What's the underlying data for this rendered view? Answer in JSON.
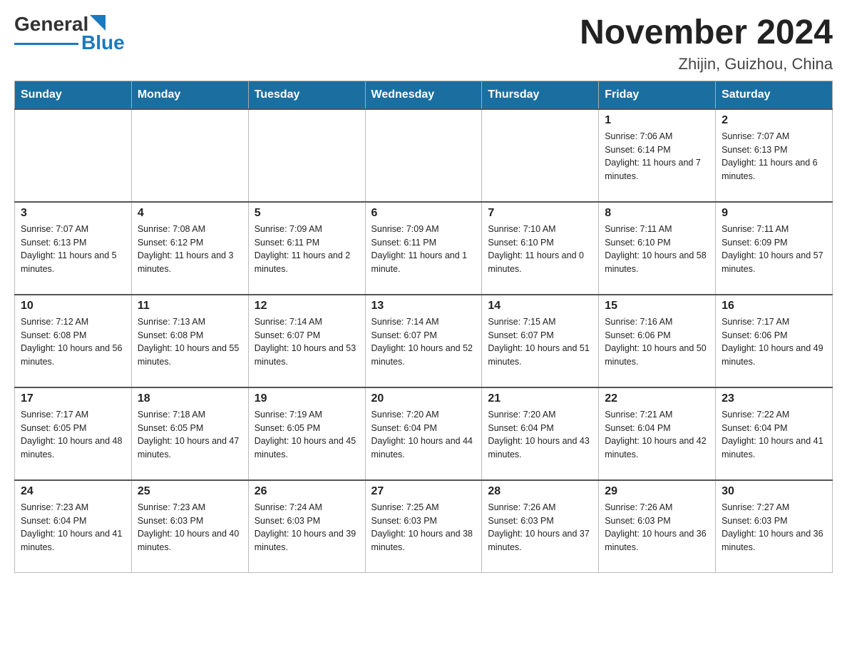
{
  "header": {
    "logo_general": "General",
    "logo_blue": "Blue",
    "main_title": "November 2024",
    "subtitle": "Zhijin, Guizhou, China"
  },
  "days_of_week": [
    "Sunday",
    "Monday",
    "Tuesday",
    "Wednesday",
    "Thursday",
    "Friday",
    "Saturday"
  ],
  "weeks": [
    [
      {
        "day": "",
        "info": ""
      },
      {
        "day": "",
        "info": ""
      },
      {
        "day": "",
        "info": ""
      },
      {
        "day": "",
        "info": ""
      },
      {
        "day": "",
        "info": ""
      },
      {
        "day": "1",
        "info": "Sunrise: 7:06 AM\nSunset: 6:14 PM\nDaylight: 11 hours and 7 minutes."
      },
      {
        "day": "2",
        "info": "Sunrise: 7:07 AM\nSunset: 6:13 PM\nDaylight: 11 hours and 6 minutes."
      }
    ],
    [
      {
        "day": "3",
        "info": "Sunrise: 7:07 AM\nSunset: 6:13 PM\nDaylight: 11 hours and 5 minutes."
      },
      {
        "day": "4",
        "info": "Sunrise: 7:08 AM\nSunset: 6:12 PM\nDaylight: 11 hours and 3 minutes."
      },
      {
        "day": "5",
        "info": "Sunrise: 7:09 AM\nSunset: 6:11 PM\nDaylight: 11 hours and 2 minutes."
      },
      {
        "day": "6",
        "info": "Sunrise: 7:09 AM\nSunset: 6:11 PM\nDaylight: 11 hours and 1 minute."
      },
      {
        "day": "7",
        "info": "Sunrise: 7:10 AM\nSunset: 6:10 PM\nDaylight: 11 hours and 0 minutes."
      },
      {
        "day": "8",
        "info": "Sunrise: 7:11 AM\nSunset: 6:10 PM\nDaylight: 10 hours and 58 minutes."
      },
      {
        "day": "9",
        "info": "Sunrise: 7:11 AM\nSunset: 6:09 PM\nDaylight: 10 hours and 57 minutes."
      }
    ],
    [
      {
        "day": "10",
        "info": "Sunrise: 7:12 AM\nSunset: 6:08 PM\nDaylight: 10 hours and 56 minutes."
      },
      {
        "day": "11",
        "info": "Sunrise: 7:13 AM\nSunset: 6:08 PM\nDaylight: 10 hours and 55 minutes."
      },
      {
        "day": "12",
        "info": "Sunrise: 7:14 AM\nSunset: 6:07 PM\nDaylight: 10 hours and 53 minutes."
      },
      {
        "day": "13",
        "info": "Sunrise: 7:14 AM\nSunset: 6:07 PM\nDaylight: 10 hours and 52 minutes."
      },
      {
        "day": "14",
        "info": "Sunrise: 7:15 AM\nSunset: 6:07 PM\nDaylight: 10 hours and 51 minutes."
      },
      {
        "day": "15",
        "info": "Sunrise: 7:16 AM\nSunset: 6:06 PM\nDaylight: 10 hours and 50 minutes."
      },
      {
        "day": "16",
        "info": "Sunrise: 7:17 AM\nSunset: 6:06 PM\nDaylight: 10 hours and 49 minutes."
      }
    ],
    [
      {
        "day": "17",
        "info": "Sunrise: 7:17 AM\nSunset: 6:05 PM\nDaylight: 10 hours and 48 minutes."
      },
      {
        "day": "18",
        "info": "Sunrise: 7:18 AM\nSunset: 6:05 PM\nDaylight: 10 hours and 47 minutes."
      },
      {
        "day": "19",
        "info": "Sunrise: 7:19 AM\nSunset: 6:05 PM\nDaylight: 10 hours and 45 minutes."
      },
      {
        "day": "20",
        "info": "Sunrise: 7:20 AM\nSunset: 6:04 PM\nDaylight: 10 hours and 44 minutes."
      },
      {
        "day": "21",
        "info": "Sunrise: 7:20 AM\nSunset: 6:04 PM\nDaylight: 10 hours and 43 minutes."
      },
      {
        "day": "22",
        "info": "Sunrise: 7:21 AM\nSunset: 6:04 PM\nDaylight: 10 hours and 42 minutes."
      },
      {
        "day": "23",
        "info": "Sunrise: 7:22 AM\nSunset: 6:04 PM\nDaylight: 10 hours and 41 minutes."
      }
    ],
    [
      {
        "day": "24",
        "info": "Sunrise: 7:23 AM\nSunset: 6:04 PM\nDaylight: 10 hours and 41 minutes."
      },
      {
        "day": "25",
        "info": "Sunrise: 7:23 AM\nSunset: 6:03 PM\nDaylight: 10 hours and 40 minutes."
      },
      {
        "day": "26",
        "info": "Sunrise: 7:24 AM\nSunset: 6:03 PM\nDaylight: 10 hours and 39 minutes."
      },
      {
        "day": "27",
        "info": "Sunrise: 7:25 AM\nSunset: 6:03 PM\nDaylight: 10 hours and 38 minutes."
      },
      {
        "day": "28",
        "info": "Sunrise: 7:26 AM\nSunset: 6:03 PM\nDaylight: 10 hours and 37 minutes."
      },
      {
        "day": "29",
        "info": "Sunrise: 7:26 AM\nSunset: 6:03 PM\nDaylight: 10 hours and 36 minutes."
      },
      {
        "day": "30",
        "info": "Sunrise: 7:27 AM\nSunset: 6:03 PM\nDaylight: 10 hours and 36 minutes."
      }
    ]
  ]
}
